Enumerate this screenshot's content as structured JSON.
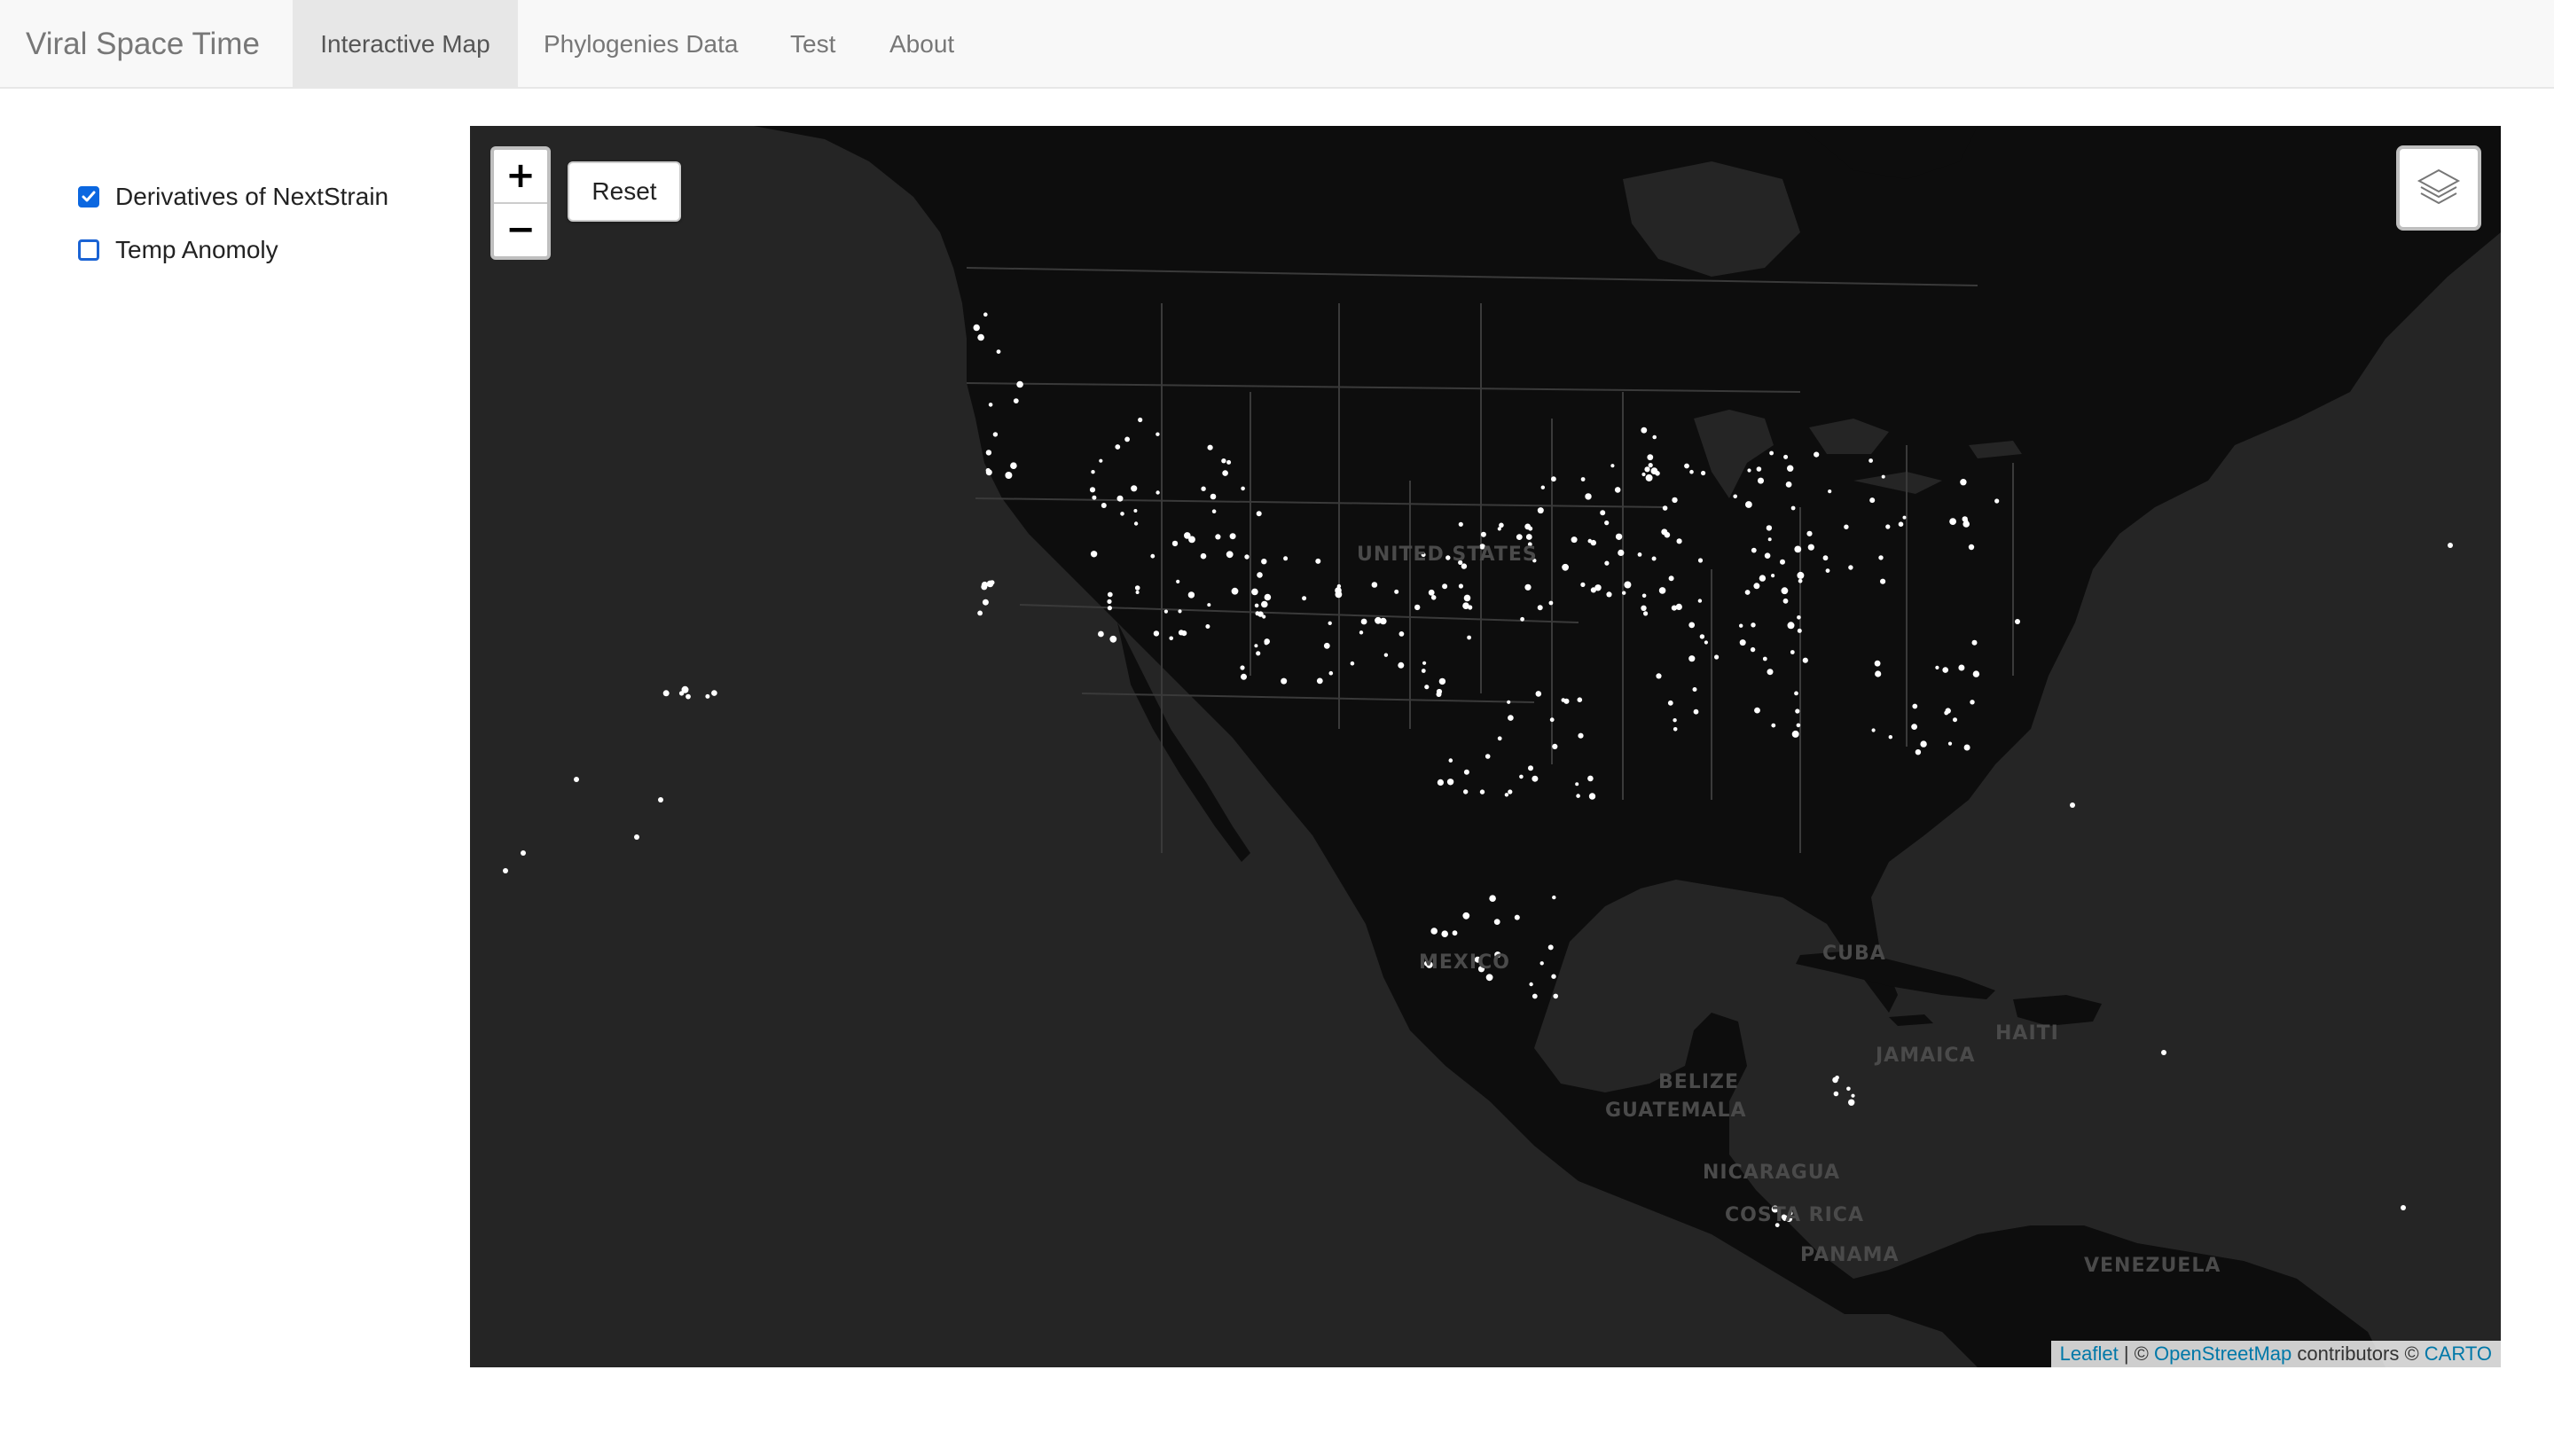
{
  "navbar": {
    "brand": "Viral Space Time",
    "tabs": [
      {
        "label": "Interactive Map",
        "active": true
      },
      {
        "label": "Phylogenies Data",
        "active": false
      },
      {
        "label": "Test",
        "active": false
      },
      {
        "label": "About",
        "active": false
      }
    ]
  },
  "sidebar": {
    "layers": [
      {
        "label": "Derivatives of NextStrain",
        "checked": true
      },
      {
        "label": "Temp Anomoly",
        "checked": false
      }
    ]
  },
  "map": {
    "zoom_in_label": "+",
    "zoom_out_label": "−",
    "reset_label": "Reset",
    "layers_icon": "layers-icon",
    "country_labels": [
      "UNITED STATES",
      "MEXICO",
      "CUBA",
      "HAITI",
      "JAMAICA",
      "BELIZE",
      "GUATEMALA",
      "NICARAGUA",
      "COSTA RICA",
      "PANAMA",
      "VENEZUELA"
    ],
    "attribution": {
      "leaflet": "Leaflet",
      "separator": " | © ",
      "osm": "OpenStreetMap",
      "contributors": " contributors © ",
      "carto": "CARTO"
    },
    "colors": {
      "ocean": "#252525",
      "land": "#0d0d0d",
      "borders": "#3a3a3a",
      "points": "#ffffff",
      "label_text": "#4a4a4a"
    }
  }
}
